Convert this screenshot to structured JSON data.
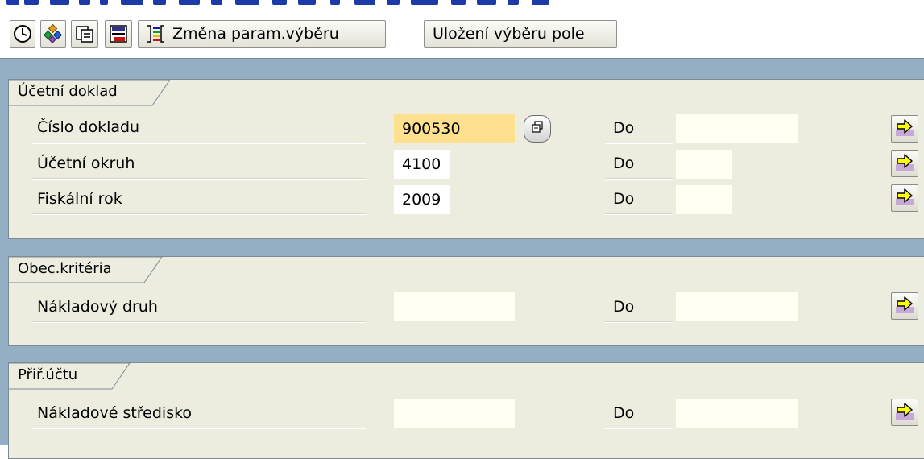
{
  "toolbar": {
    "buttons": [
      {
        "icon": "execute-clock-icon"
      },
      {
        "icon": "dynamic-selection-icon"
      },
      {
        "icon": "get-variant-icon"
      },
      {
        "icon": "save-variant-icon"
      }
    ],
    "change_selection_label": "Změna param.výběru",
    "save_field_selection_label": "Uložení výběru pole"
  },
  "groups": [
    {
      "title": "Účetní doklad",
      "fields": [
        {
          "label": "Číslo dokladu",
          "value": "900530",
          "to_label": "Do",
          "to_value": ""
        },
        {
          "label": "Účetní okruh",
          "value": "4100",
          "to_label": "Do",
          "to_value": ""
        },
        {
          "label": "Fiskální rok",
          "value": "2009",
          "to_label": "Do",
          "to_value": ""
        }
      ]
    },
    {
      "title": "Obec.kritéria",
      "fields": [
        {
          "label": "Nákladový druh",
          "value": "",
          "to_label": "Do",
          "to_value": ""
        }
      ]
    },
    {
      "title": "Přiř.účtu",
      "fields": [
        {
          "label": "Nákladové středisko",
          "value": "",
          "to_label": "Do",
          "to_value": ""
        }
      ]
    }
  ],
  "colors": {
    "background_area": "#94aec4",
    "group_fill": "#ededdf",
    "input_empty": "#fffff2",
    "input_focus": "#ffe08f",
    "arrow_fill": "#ffff00"
  }
}
